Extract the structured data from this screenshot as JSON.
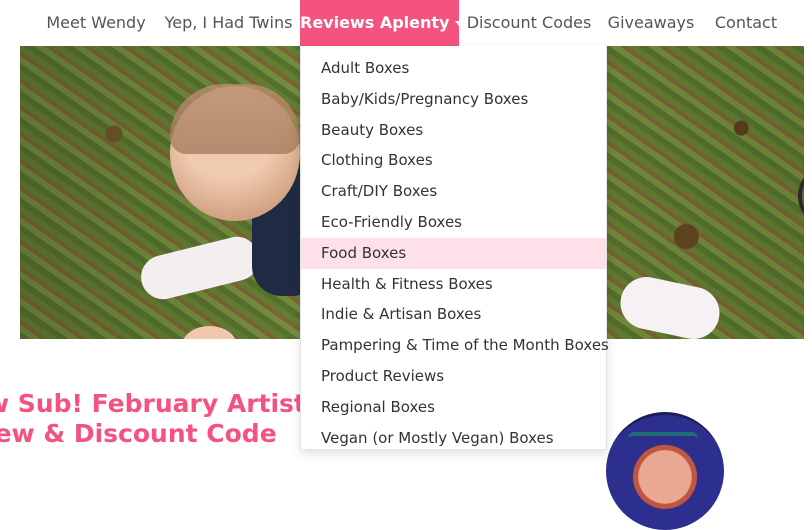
{
  "nav": {
    "items": [
      {
        "label": "Meet Wendy"
      },
      {
        "label": "Yep, I Had Twins"
      },
      {
        "label": "Reviews Aplenty"
      },
      {
        "label": "Discount Codes"
      },
      {
        "label": "Giveaways"
      },
      {
        "label": "Contact"
      }
    ],
    "active_index": 2,
    "accent_color": "#f4537f"
  },
  "dropdown": {
    "items": [
      {
        "label": "Adult Boxes"
      },
      {
        "label": "Baby/Kids/Pregnancy Boxes"
      },
      {
        "label": "Beauty Boxes"
      },
      {
        "label": "Clothing Boxes"
      },
      {
        "label": "Craft/DIY Boxes"
      },
      {
        "label": "Eco-Friendly Boxes"
      },
      {
        "label": "Food Boxes"
      },
      {
        "label": "Health & Fitness Boxes"
      },
      {
        "label": "Indie & Artisan Boxes"
      },
      {
        "label": "Pampering & Time of the Month Boxes"
      },
      {
        "label": "Product Reviews"
      },
      {
        "label": "Regional Boxes"
      },
      {
        "label": "Vegan (or Mostly Vegan) Boxes"
      }
    ],
    "hovered_index": 6,
    "hover_color": "#fde0e8"
  },
  "post": {
    "title_line1": "w Sub! February Artistry",
    "title_line2": "iew & Discount Code"
  },
  "hero": {
    "icon": "photo-baby-in-leaves"
  }
}
